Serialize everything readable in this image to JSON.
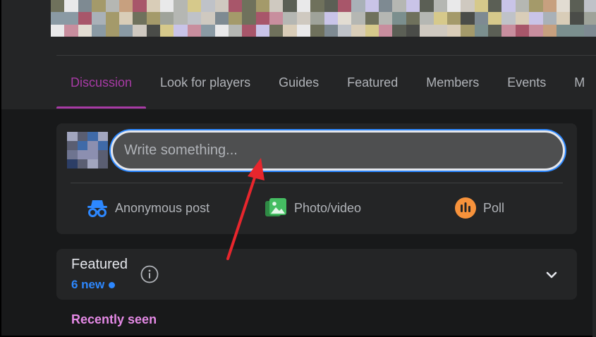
{
  "tabs": [
    {
      "label": "Discussion",
      "active": true
    },
    {
      "label": "Look for players",
      "active": false
    },
    {
      "label": "Guides",
      "active": false
    },
    {
      "label": "Featured",
      "active": false
    },
    {
      "label": "Members",
      "active": false
    },
    {
      "label": "Events",
      "active": false
    },
    {
      "label": "M",
      "active": false
    }
  ],
  "composer": {
    "placeholder": "Write something...",
    "actions": [
      {
        "label": "Anonymous post",
        "icon": "incognito-icon"
      },
      {
        "label": "Photo/video",
        "icon": "photo-icon"
      },
      {
        "label": "Poll",
        "icon": "poll-icon"
      }
    ]
  },
  "featured": {
    "title": "Featured",
    "new_label": "6 new"
  },
  "recently_seen": "Recently seen",
  "colors": {
    "accent_purple": "#a83ba5",
    "accent_blue": "#2d88ff",
    "recently_seen_pink": "#e58ae6",
    "annotation_red": "#e8262d",
    "poll_orange": "#f7923b",
    "photo_green": "#45bd62"
  }
}
